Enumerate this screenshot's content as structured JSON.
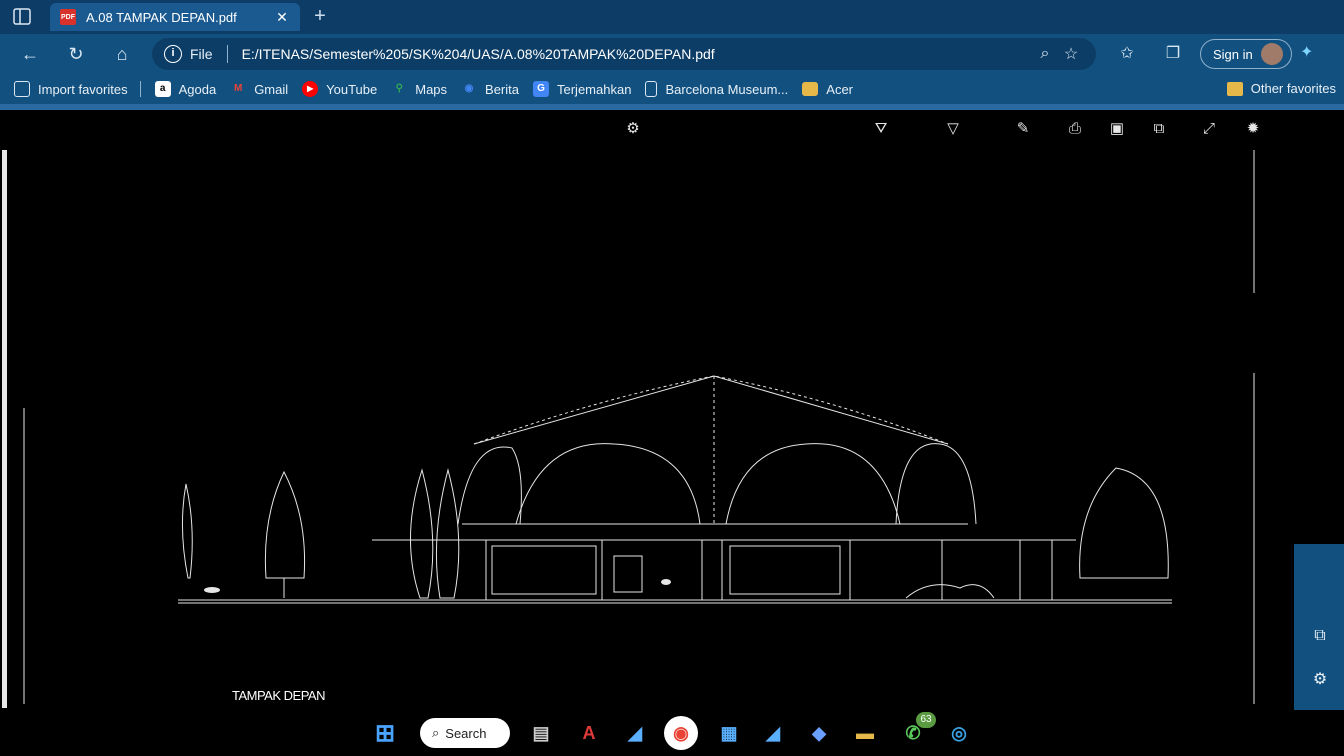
{
  "browser": {
    "tab_title": "A.08 TAMPAK DEPAN.pdf",
    "pdf_badge": "PDF",
    "close_glyph": "✕",
    "new_tab_glyph": "+",
    "file_label": "File",
    "url": "E:/ITENAS/Semester%205/SK%204/UAS/A.08%20TAMPAK%20DEPAN.pdf",
    "sign_in": "Sign in"
  },
  "bookmarks": [
    {
      "label": "Import favorites",
      "icon": "import-icon",
      "color": "#2a6aa0"
    },
    {
      "label": "Agoda",
      "icon": "agoda-icon",
      "color": "#ffffff"
    },
    {
      "label": "Gmail",
      "icon": "gmail-icon",
      "color": "#ea4335"
    },
    {
      "label": "YouTube",
      "icon": "youtube-icon",
      "color": "#ff0000"
    },
    {
      "label": "Maps",
      "icon": "maps-icon",
      "color": "#34a853"
    },
    {
      "label": "Berita",
      "icon": "news-icon",
      "color": "#4285f4"
    },
    {
      "label": "Terjemahkan",
      "icon": "translate-icon",
      "color": "#4285f4"
    },
    {
      "label": "Barcelona Museum...",
      "icon": "page-icon",
      "color": "#2a6aa0"
    },
    {
      "label": "Acer",
      "icon": "folder-icon",
      "color": "#e6b84a"
    }
  ],
  "other_favorites": "Other favorites",
  "document": {
    "caption": "TAMPAK DEPAN"
  },
  "taskbar": {
    "search_label": "Search",
    "whatsapp_badge": "63"
  }
}
